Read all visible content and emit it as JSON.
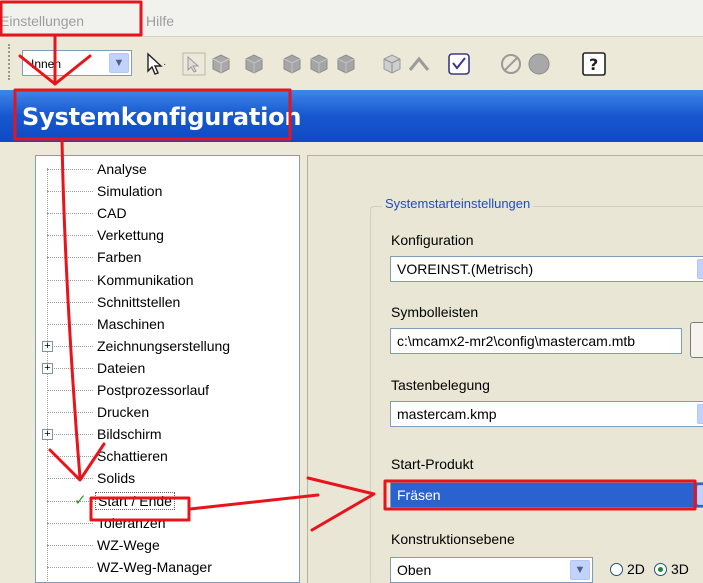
{
  "menu": {
    "items": [
      "Einstellungen",
      "Hilfe"
    ]
  },
  "toolbar": {
    "view_select": "Innen",
    "icons": [
      "cursor-arrow-icon",
      "select-arrow-icon",
      "cube-select-icon",
      "cube-icon",
      "cube-icon",
      "cube-icon",
      "cube-icon",
      "cube-wireframe-icon",
      "chevron-up-icon",
      "checklist-icon",
      "circle-slash-icon",
      "sphere-icon",
      "help-icon"
    ]
  },
  "window": {
    "title": "Systemkonfiguration"
  },
  "tree": {
    "items": [
      {
        "label": "Analyse",
        "expandable": false
      },
      {
        "label": "Simulation",
        "expandable": false
      },
      {
        "label": "CAD",
        "expandable": false
      },
      {
        "label": "Verkettung",
        "expandable": false
      },
      {
        "label": "Farben",
        "expandable": false
      },
      {
        "label": "Kommunikation",
        "expandable": false
      },
      {
        "label": "Schnittstellen",
        "expandable": false
      },
      {
        "label": "Maschinen",
        "expandable": false
      },
      {
        "label": "Zeichnungserstellung",
        "expandable": true
      },
      {
        "label": "Dateien",
        "expandable": true
      },
      {
        "label": "Postprozessorlauf",
        "expandable": false
      },
      {
        "label": "Drucken",
        "expandable": false
      },
      {
        "label": "Bildschirm",
        "expandable": true
      },
      {
        "label": "Schattieren",
        "expandable": false
      },
      {
        "label": "Solids",
        "expandable": false
      },
      {
        "label": "Start / Ende",
        "expandable": false,
        "selected": true,
        "checked": true
      },
      {
        "label": "Toleranzen",
        "expandable": false
      },
      {
        "label": "WZ-Wege",
        "expandable": false
      },
      {
        "label": "WZ-Weg-Manager",
        "expandable": false
      }
    ]
  },
  "panel": {
    "group_title": "Systemstarteinstellungen",
    "konfiguration_label": "Konfiguration",
    "konfiguration_value": "VOREINST.(Metrisch)",
    "symbolleisten_label": "Symbolleisten",
    "symbolleisten_value": "c:\\mcamx2-mr2\\config\\mastercam.mtb",
    "tastenbelegung_label": "Tastenbelegung",
    "tastenbelegung_value": "mastercam.kmp",
    "startprodukt_label": "Start-Produkt",
    "startprodukt_value": "Fräsen",
    "konstruktionsebene_label": "Konstruktionsebene",
    "konstruktionsebene_value": "Oben",
    "radio_2d": "2D",
    "radio_3d": "3D"
  },
  "colors": {
    "annotation_red": "#e8141c",
    "title_blue": "#1657cf"
  }
}
